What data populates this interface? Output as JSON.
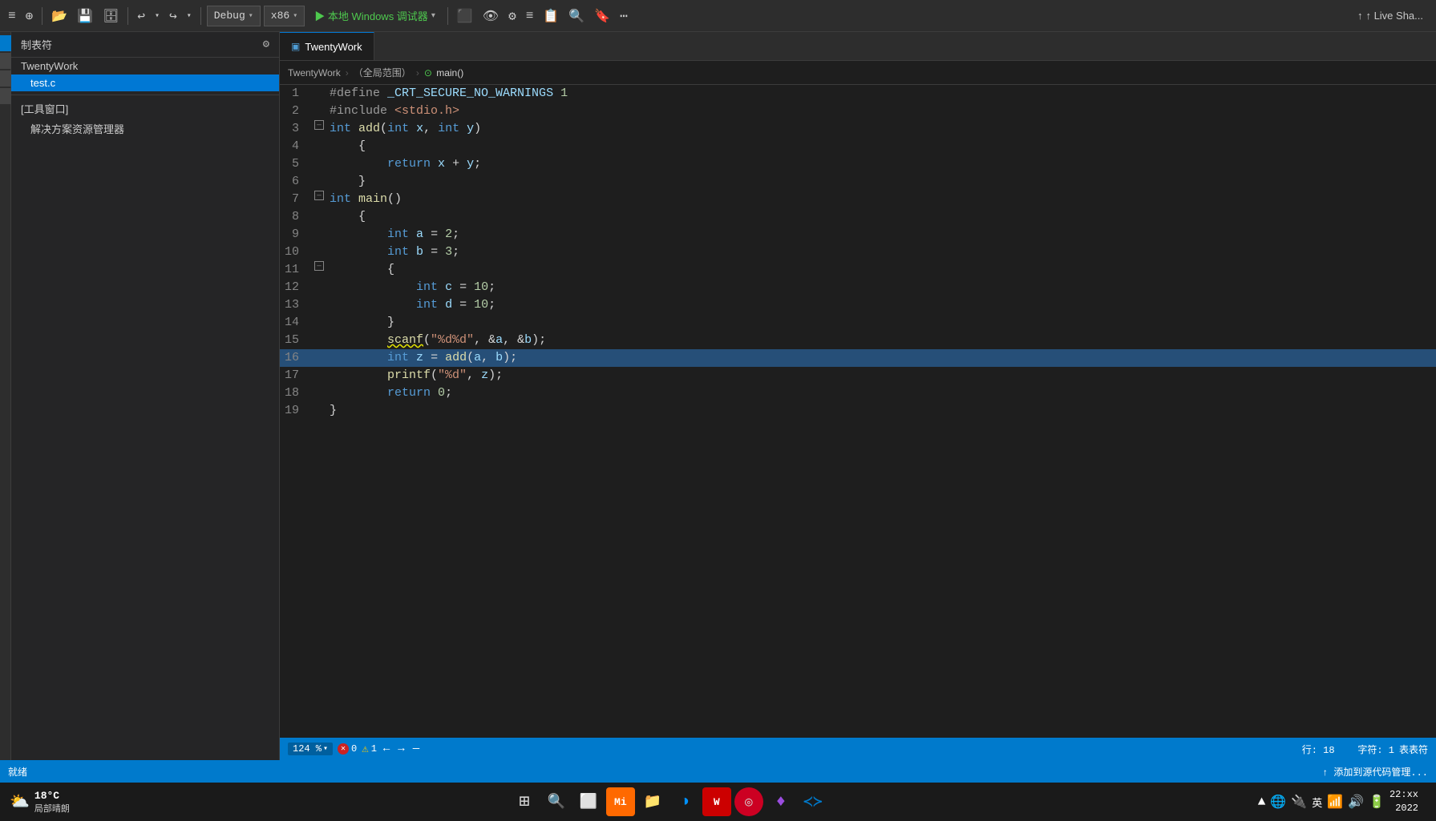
{
  "toolbar": {
    "debug_label": "Debug",
    "platform_label": "x86",
    "run_label": "▶ 本地 Windows 调试器",
    "live_share_label": "↑ Live Sha..."
  },
  "breadcrumb": {
    "project": "TwentyWork",
    "scope": "（全局范围）",
    "function": "main()"
  },
  "solution_explorer": {
    "header": "制表符",
    "project_name": "TwentyWork",
    "file_name": "test.c",
    "tools_label": "[工具窗口]",
    "solution_label": "解决方案资源管理器"
  },
  "tab": {
    "icon": "▣",
    "label": "TwentyWork"
  },
  "code_lines": [
    {
      "num": 1,
      "tokens": [
        {
          "t": "pp",
          "v": "#define"
        },
        {
          "t": "op",
          "v": " "
        },
        {
          "t": "var",
          "v": "_CRT_SECURE_NO_WARNINGS"
        },
        {
          "t": "op",
          "v": " "
        },
        {
          "t": "num",
          "v": "1"
        }
      ],
      "fold": false
    },
    {
      "num": 2,
      "tokens": [
        {
          "t": "pp",
          "v": "#include"
        },
        {
          "t": "op",
          "v": " "
        },
        {
          "t": "str",
          "v": "<stdio.h>"
        }
      ],
      "fold": false
    },
    {
      "num": 3,
      "tokens": [
        {
          "t": "kw",
          "v": "int"
        },
        {
          "t": "op",
          "v": " "
        },
        {
          "t": "fn",
          "v": "add"
        },
        {
          "t": "op",
          "v": "("
        },
        {
          "t": "kw",
          "v": "int"
        },
        {
          "t": "op",
          "v": " "
        },
        {
          "t": "var",
          "v": "x"
        },
        {
          "t": "op",
          "v": ", "
        },
        {
          "t": "kw",
          "v": "int"
        },
        {
          "t": "op",
          "v": " "
        },
        {
          "t": "var",
          "v": "y"
        },
        {
          "t": "op",
          "v": ")"
        }
      ],
      "fold": true
    },
    {
      "num": 4,
      "tokens": [
        {
          "t": "op",
          "v": "    {"
        }
      ],
      "fold": false,
      "indent": 1
    },
    {
      "num": 5,
      "tokens": [
        {
          "t": "op",
          "v": "        "
        },
        {
          "t": "kw",
          "v": "return"
        },
        {
          "t": "op",
          "v": " "
        },
        {
          "t": "var",
          "v": "x"
        },
        {
          "t": "op",
          "v": " + "
        },
        {
          "t": "var",
          "v": "y"
        },
        {
          "t": "op",
          "v": ";"
        }
      ],
      "fold": false,
      "indent": 1
    },
    {
      "num": 6,
      "tokens": [
        {
          "t": "op",
          "v": "    }"
        }
      ],
      "fold": false,
      "indent": 1
    },
    {
      "num": 7,
      "tokens": [
        {
          "t": "kw",
          "v": "int"
        },
        {
          "t": "op",
          "v": " "
        },
        {
          "t": "fn",
          "v": "main"
        },
        {
          "t": "op",
          "v": "()"
        }
      ],
      "fold": true
    },
    {
      "num": 8,
      "tokens": [
        {
          "t": "op",
          "v": "    {"
        }
      ],
      "fold": false,
      "indent": 1
    },
    {
      "num": 9,
      "tokens": [
        {
          "t": "op",
          "v": "        "
        },
        {
          "t": "kw",
          "v": "int"
        },
        {
          "t": "op",
          "v": " "
        },
        {
          "t": "var",
          "v": "a"
        },
        {
          "t": "op",
          "v": " = "
        },
        {
          "t": "num",
          "v": "2"
        },
        {
          "t": "op",
          "v": ";"
        }
      ],
      "fold": false,
      "indent": 1
    },
    {
      "num": 10,
      "tokens": [
        {
          "t": "op",
          "v": "        "
        },
        {
          "t": "kw",
          "v": "int"
        },
        {
          "t": "op",
          "v": " "
        },
        {
          "t": "var",
          "v": "b"
        },
        {
          "t": "op",
          "v": " = "
        },
        {
          "t": "num",
          "v": "3"
        },
        {
          "t": "op",
          "v": ";"
        }
      ],
      "fold": false,
      "indent": 1
    },
    {
      "num": 11,
      "tokens": [
        {
          "t": "op",
          "v": "        {"
        }
      ],
      "fold": true,
      "indent": 1
    },
    {
      "num": 12,
      "tokens": [
        {
          "t": "op",
          "v": "            "
        },
        {
          "t": "kw",
          "v": "int"
        },
        {
          "t": "op",
          "v": " "
        },
        {
          "t": "var",
          "v": "c"
        },
        {
          "t": "op",
          "v": " = "
        },
        {
          "t": "num",
          "v": "10"
        },
        {
          "t": "op",
          "v": ";"
        }
      ],
      "fold": false,
      "indent": 2
    },
    {
      "num": 13,
      "tokens": [
        {
          "t": "op",
          "v": "            "
        },
        {
          "t": "kw",
          "v": "int"
        },
        {
          "t": "op",
          "v": " "
        },
        {
          "t": "var",
          "v": "d"
        },
        {
          "t": "op",
          "v": " = "
        },
        {
          "t": "num",
          "v": "10"
        },
        {
          "t": "op",
          "v": ";"
        }
      ],
      "fold": false,
      "indent": 2
    },
    {
      "num": 14,
      "tokens": [
        {
          "t": "op",
          "v": "        }"
        }
      ],
      "fold": false,
      "indent": 1
    },
    {
      "num": 15,
      "tokens": [
        {
          "t": "op",
          "v": "        "
        },
        {
          "t": "fn",
          "v": "scanf",
          "squiggle": "warn"
        },
        {
          "t": "op",
          "v": "("
        },
        {
          "t": "str",
          "v": "\"%d%d\""
        },
        {
          "t": "op",
          "v": ", &"
        },
        {
          "t": "var",
          "v": "a"
        },
        {
          "t": "op",
          "v": ", &"
        },
        {
          "t": "var",
          "v": "b"
        },
        {
          "t": "op",
          "v": ");"
        }
      ],
      "fold": false,
      "indent": 1
    },
    {
      "num": 16,
      "tokens": [
        {
          "t": "op",
          "v": "        "
        },
        {
          "t": "kw",
          "v": "int"
        },
        {
          "t": "op",
          "v": " "
        },
        {
          "t": "var",
          "v": "z"
        },
        {
          "t": "op",
          "v": " = "
        },
        {
          "t": "fn",
          "v": "add"
        },
        {
          "t": "op",
          "v": "("
        },
        {
          "t": "var",
          "v": "a"
        },
        {
          "t": "op",
          "v": ", "
        },
        {
          "t": "var",
          "v": "b"
        },
        {
          "t": "op",
          "v": ");"
        }
      ],
      "fold": false,
      "indent": 1,
      "highlight": true
    },
    {
      "num": 17,
      "tokens": [
        {
          "t": "op",
          "v": "        "
        },
        {
          "t": "fn",
          "v": "printf"
        },
        {
          "t": "op",
          "v": "("
        },
        {
          "t": "str",
          "v": "\"%d\""
        },
        {
          "t": "op",
          "v": ", "
        },
        {
          "t": "var",
          "v": "z"
        },
        {
          "t": "op",
          "v": ");"
        }
      ],
      "fold": false,
      "indent": 1
    },
    {
      "num": 18,
      "tokens": [
        {
          "t": "op",
          "v": "        "
        },
        {
          "t": "kw",
          "v": "return"
        },
        {
          "t": "op",
          "v": " "
        },
        {
          "t": "num",
          "v": "0"
        },
        {
          "t": "op",
          "v": ";"
        }
      ],
      "fold": false,
      "indent": 1
    },
    {
      "num": 19,
      "tokens": [
        {
          "t": "op",
          "v": "}"
        }
      ],
      "fold": false
    }
  ],
  "status_bar": {
    "zoom": "124 %",
    "errors": "0",
    "warnings": "1",
    "row": "行: 18",
    "col": "字符: 1",
    "encoding": "表表符"
  },
  "bottom_bar": {
    "status": "就绪",
    "action": "↑ 添加到源代码管理..."
  },
  "taskbar": {
    "weather": "18°C 局部晴朗",
    "time": "2022",
    "lang": "英"
  }
}
